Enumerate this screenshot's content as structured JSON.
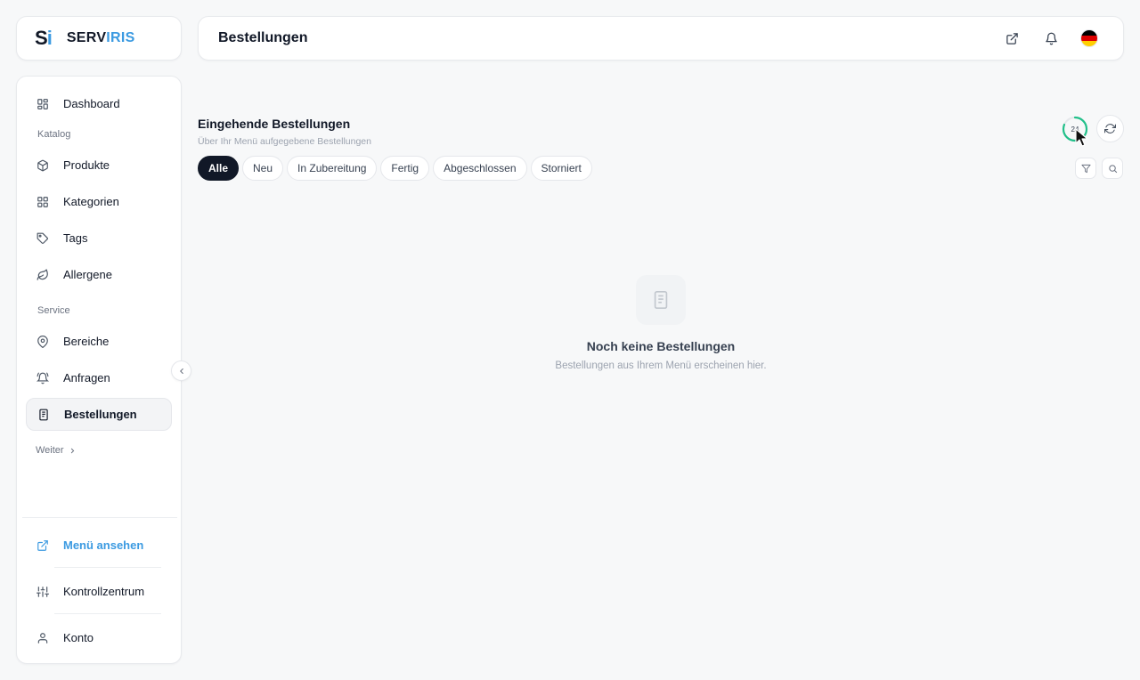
{
  "brand": {
    "mark_s": "S",
    "mark_i": "i",
    "name_a": "SERV",
    "name_b": "IRIS"
  },
  "header": {
    "title": "Bestellungen",
    "icons": [
      "external-link-icon",
      "bell-icon",
      "german-flag-icon"
    ]
  },
  "sidebar": {
    "top_item": {
      "label": "Dashboard",
      "icon": "dashboard-icon"
    },
    "catalog_label": "Katalog",
    "catalog_items": [
      {
        "label": "Produkte",
        "icon": "box-icon"
      },
      {
        "label": "Kategorien",
        "icon": "grid-icon"
      },
      {
        "label": "Tags",
        "icon": "tag-icon"
      },
      {
        "label": "Allergene",
        "icon": "leaf-icon"
      }
    ],
    "service_label": "Service",
    "service_items": [
      {
        "label": "Bereiche",
        "icon": "location-pin-icon"
      },
      {
        "label": "Anfragen",
        "icon": "bell-icon"
      },
      {
        "label": "Bestellungen",
        "icon": "receipt-icon",
        "active": true
      }
    ],
    "more_label": "Weiter",
    "bottom_items": [
      {
        "label": "Menü ansehen",
        "icon": "external-link-icon"
      },
      {
        "label": "Kontrollzentrum",
        "icon": "sliders-icon"
      },
      {
        "label": "Konto",
        "icon": "user-icon"
      }
    ]
  },
  "main": {
    "heading": "Eingehende Bestellungen",
    "subheading": "Über Ihr Menü aufgegebene Bestellungen",
    "tabs": [
      {
        "label": "Alle",
        "active": true
      },
      {
        "label": "Neu"
      },
      {
        "label": "In Zubereitung"
      },
      {
        "label": "Fertig"
      },
      {
        "label": "Abgeschlossen"
      },
      {
        "label": "Storniert"
      }
    ],
    "refresh_timer": "24",
    "empty": {
      "title": "Noch keine Bestellungen",
      "subtitle": "Bestellungen aus Ihrem Menü erscheinen hier."
    }
  },
  "colors": {
    "accent": "#3b9ae1",
    "dark": "#111827",
    "timer_ring": "#22c08a",
    "flag_black": "#000000",
    "flag_red": "#dd0000",
    "flag_gold": "#ffce00"
  }
}
